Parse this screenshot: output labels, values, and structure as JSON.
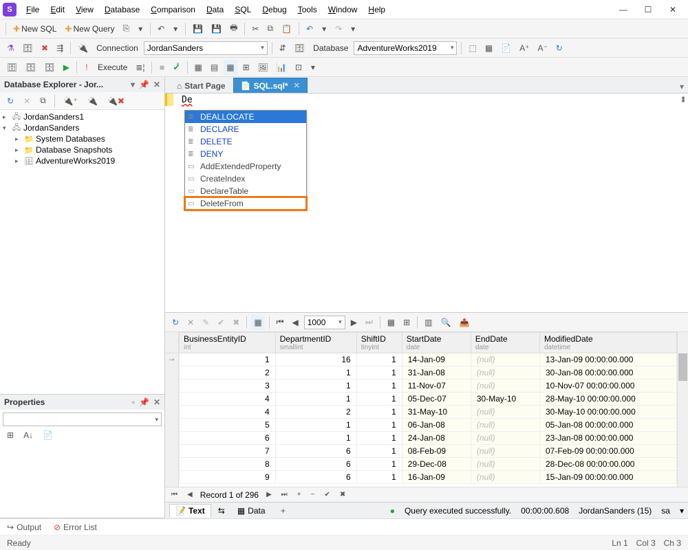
{
  "app": {
    "icon_letter": "S"
  },
  "menu": [
    "File",
    "Edit",
    "View",
    "Database",
    "Comparison",
    "Data",
    "SQL",
    "Debug",
    "Tools",
    "Window",
    "Help"
  ],
  "toolbar1": {
    "new_sql": "New SQL",
    "new_query": "New Query"
  },
  "toolbar2": {
    "connection_label": "Connection",
    "connection_value": "JordanSanders",
    "database_label": "Database",
    "database_value": "AdventureWorks2019"
  },
  "toolbar3": {
    "execute": "Execute"
  },
  "db_explorer": {
    "title": "Database Explorer - Jor...",
    "nodes": [
      {
        "label": "JordanSanders1",
        "icon": "server",
        "depth": 0,
        "expand": "▸"
      },
      {
        "label": "JordanSanders",
        "icon": "server",
        "depth": 0,
        "expand": "▾"
      },
      {
        "label": "System Databases",
        "icon": "folder",
        "depth": 1,
        "expand": "▸"
      },
      {
        "label": "Database Snapshots",
        "icon": "folder",
        "depth": 1,
        "expand": "▸"
      },
      {
        "label": "AdventureWorks2019",
        "icon": "db",
        "depth": 1,
        "expand": "▸"
      }
    ]
  },
  "properties": {
    "title": "Properties"
  },
  "tabs": {
    "start": "Start Page",
    "active": "SQL.sql*"
  },
  "editor": {
    "typed": "De"
  },
  "autocomplete": [
    {
      "label": "DEALLOCATE",
      "kind": "kw",
      "sel": true
    },
    {
      "label": "DECLARE",
      "kind": "kw"
    },
    {
      "label": "DELETE",
      "kind": "kw"
    },
    {
      "label": "DENY",
      "kind": "kw"
    },
    {
      "label": "AddExtendedProperty",
      "kind": "snip"
    },
    {
      "label": "CreateIndex",
      "kind": "snip"
    },
    {
      "label": "DeclareTable",
      "kind": "snip"
    },
    {
      "label": "DeleteFrom",
      "kind": "snip",
      "hl": true
    }
  ],
  "grid": {
    "page_size": "1000",
    "columns": [
      {
        "name": "BusinessEntityID",
        "type": "int",
        "align": "num"
      },
      {
        "name": "DepartmentID",
        "type": "smallint",
        "align": "num"
      },
      {
        "name": "ShiftID",
        "type": "tinyint",
        "align": "num"
      },
      {
        "name": "StartDate",
        "type": "date",
        "align": "date"
      },
      {
        "name": "EndDate",
        "type": "date",
        "align": "date"
      },
      {
        "name": "ModifiedDate",
        "type": "datetime",
        "align": "date"
      }
    ],
    "rows": [
      [
        "1",
        "16",
        "1",
        "14-Jan-09",
        "(null)",
        "13-Jan-09 00:00:00.000"
      ],
      [
        "2",
        "1",
        "1",
        "31-Jan-08",
        "(null)",
        "30-Jan-08 00:00:00.000"
      ],
      [
        "3",
        "1",
        "1",
        "11-Nov-07",
        "(null)",
        "10-Nov-07 00:00:00.000"
      ],
      [
        "4",
        "1",
        "1",
        "05-Dec-07",
        "30-May-10",
        "28-May-10 00:00:00.000"
      ],
      [
        "4",
        "2",
        "1",
        "31-May-10",
        "(null)",
        "30-May-10 00:00:00.000"
      ],
      [
        "5",
        "1",
        "1",
        "06-Jan-08",
        "(null)",
        "05-Jan-08 00:00:00.000"
      ],
      [
        "6",
        "1",
        "1",
        "24-Jan-08",
        "(null)",
        "23-Jan-08 00:00:00.000"
      ],
      [
        "7",
        "6",
        "1",
        "08-Feb-09",
        "(null)",
        "07-Feb-09 00:00:00.000"
      ],
      [
        "8",
        "6",
        "1",
        "29-Dec-08",
        "(null)",
        "28-Dec-08 00:00:00.000"
      ],
      [
        "9",
        "6",
        "1",
        "16-Jan-09",
        "(null)",
        "15-Jan-09 00:00:00.000"
      ]
    ],
    "record_pos": "Record 1 of 296"
  },
  "bottom_tabs": {
    "text": "Text",
    "data": "Data"
  },
  "status": {
    "query_ok": "Query executed successfully.",
    "elapsed": "00:00:00.608",
    "conn": "JordanSanders (15)",
    "user": "sa"
  },
  "output_bar": {
    "output": "Output",
    "error_list": "Error List"
  },
  "statusbar": {
    "ready": "Ready",
    "ln": "Ln 1",
    "col": "Col 3",
    "ch": "Ch 3"
  }
}
